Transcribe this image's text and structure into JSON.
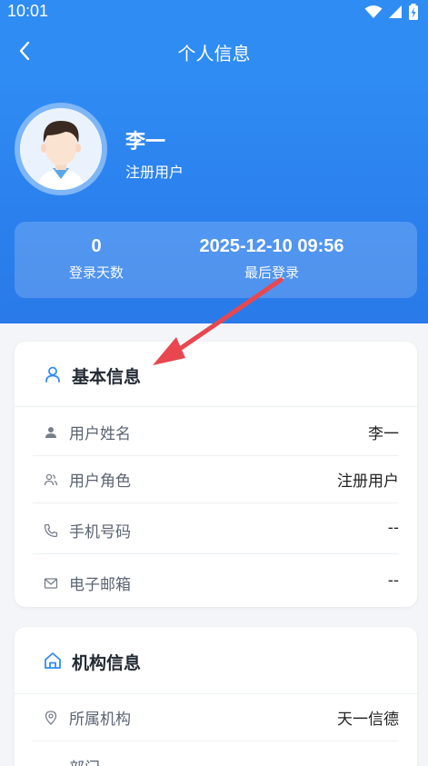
{
  "status_bar": {
    "time": "10:01"
  },
  "nav": {
    "title": "个人信息"
  },
  "profile": {
    "name": "李一",
    "role": "注册用户"
  },
  "stats": {
    "login_days_value": "0",
    "login_days_label": "登录天数",
    "last_login_value": "2025-12-10 09:56",
    "last_login_label": "最后登录"
  },
  "basic_info": {
    "title": "基本信息",
    "rows": [
      {
        "label": "用户姓名",
        "value": "李一",
        "icon": "person-icon"
      },
      {
        "label": "用户角色",
        "value": "注册用户",
        "icon": "users-icon"
      },
      {
        "label": "手机号码",
        "value": "--",
        "icon": "phone-icon"
      },
      {
        "label": "电子邮箱",
        "value": "--",
        "icon": "mail-icon"
      }
    ]
  },
  "org_info": {
    "title": "机构信息",
    "rows": [
      {
        "label": "所属机构",
        "value": "天一信德",
        "icon": "location-pin-icon"
      },
      {
        "label": "部门",
        "value": ""
      }
    ]
  },
  "colors": {
    "primary": "#2f8cf3",
    "annotation_arrow": "#e8474f"
  }
}
